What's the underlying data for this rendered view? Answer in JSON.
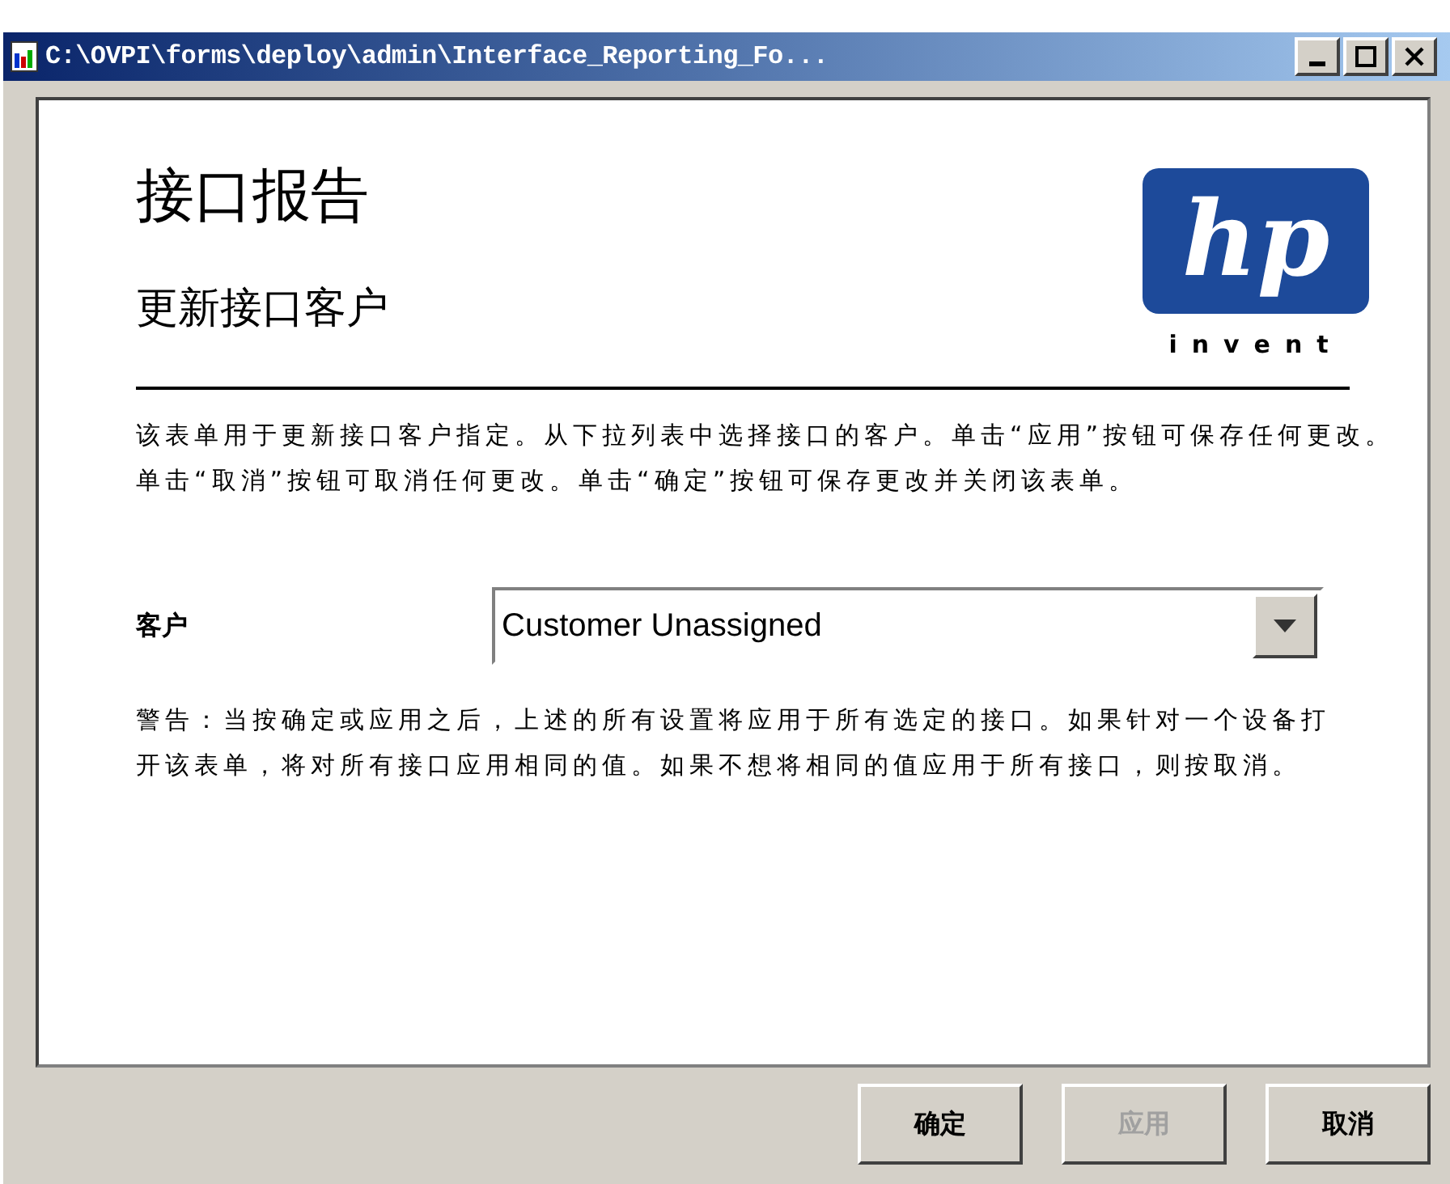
{
  "window": {
    "title": "C:\\OVPI\\forms\\deploy\\admin\\Interface_Reporting_Fo..."
  },
  "header": {
    "title": "接口报告",
    "subtitle": "更新接口客户",
    "logo": {
      "mark": "hp",
      "tagline": "invent"
    }
  },
  "description": "该表单用于更新接口客户指定。从下拉列表中选择接口的客户。单击“应用”按钮可保存任何更改。单击“取消”按钮可取消任何更改。单击“确定”按钮可保存更改并关闭该表单。",
  "customer_field": {
    "label": "客户",
    "value": "Customer Unassigned"
  },
  "warning": "警告：当按确定或应用之后，上述的所有设置将应用于所有选定的接口。如果针对一个设备打开该表单，将对所有接口应用相同的值。如果不想将相同的值应用于所有接口，则按取消。",
  "buttons": [
    {
      "label": "确定",
      "disabled": false
    },
    {
      "label": "应用",
      "disabled": true
    },
    {
      "label": "取消",
      "disabled": false
    }
  ]
}
